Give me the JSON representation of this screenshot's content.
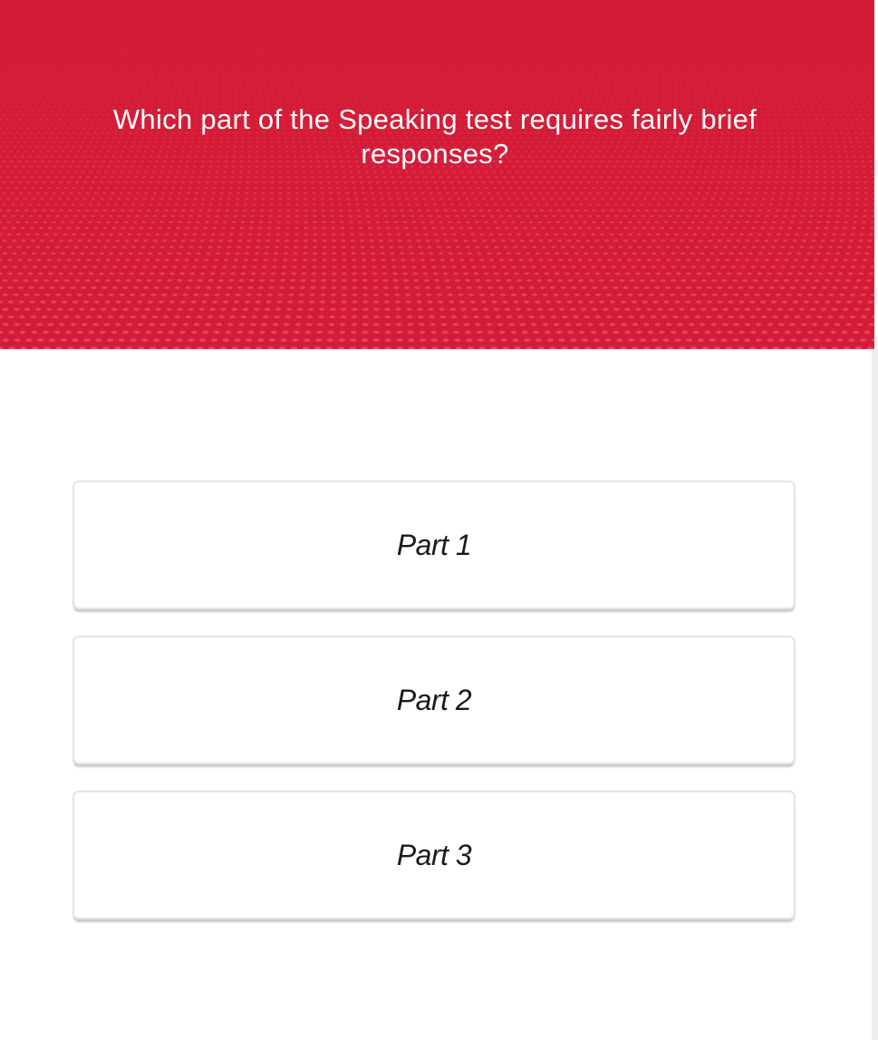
{
  "quiz": {
    "question": "Which part of the Speaking test requires fairly brief responses?",
    "options": [
      {
        "label": "Part 1"
      },
      {
        "label": "Part 2"
      },
      {
        "label": "Part 3"
      }
    ]
  },
  "colors": {
    "header_background": "#d41b38",
    "header_dots": "#f0606f",
    "question_text": "#ffffff",
    "option_border": "#e4e4e4",
    "option_text": "#1a1a1a"
  }
}
